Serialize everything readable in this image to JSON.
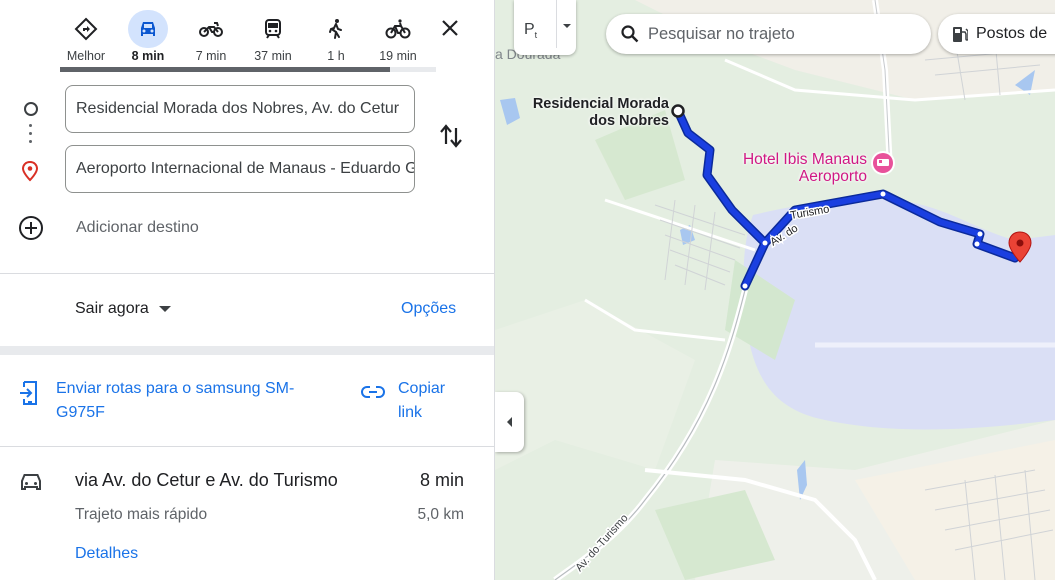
{
  "travel_modes": [
    {
      "name": "best",
      "label": "Melhor",
      "icon": "directions-diamond-icon"
    },
    {
      "name": "car",
      "label": "8 min",
      "icon": "car-icon",
      "active": true
    },
    {
      "name": "motorcycle",
      "label": "7 min",
      "icon": "motorcycle-icon"
    },
    {
      "name": "transit",
      "label": "37 min",
      "icon": "train-icon"
    },
    {
      "name": "walk",
      "label": "1 h",
      "icon": "walk-icon"
    },
    {
      "name": "bicycle",
      "label": "19 min",
      "icon": "bicycle-icon"
    }
  ],
  "route_inputs": {
    "origin": "Residencial Morada dos Nobres, Av. do Cetur",
    "destination": "Aeroporto Internacional de Manaus - Eduardo Gomes"
  },
  "add_destination_label": "Adicionar destino",
  "departure": {
    "label": "Sair agora",
    "options_label": "Opções"
  },
  "share": {
    "send_label": "Enviar rotas para o samsung SM-G975F",
    "copy_label": "Copiar link"
  },
  "route": {
    "name": "via Av. do Cetur e Av. do Turismo",
    "time": "8 min",
    "subtitle": "Trajeto mais rápido",
    "distance": "5,0 km",
    "details_label": "Detalhes"
  },
  "map": {
    "search_placeholder": "Pesquisar no trajeto",
    "chip_label": "Postos de",
    "origin_label_line1": "Residencial Morada",
    "origin_label_line2": "dos Nobres",
    "hotel_label_line1": "Hotel Ibis Manaus",
    "hotel_label_line2": "Aeroporto",
    "road_label_1": "Av. do Turismo",
    "road_label_2": "Av. do Turismo",
    "faded_label": "a Dourada",
    "route_color": "#1a3fe0",
    "water_color": "#dadff5",
    "pin_color": "#ea4335"
  }
}
